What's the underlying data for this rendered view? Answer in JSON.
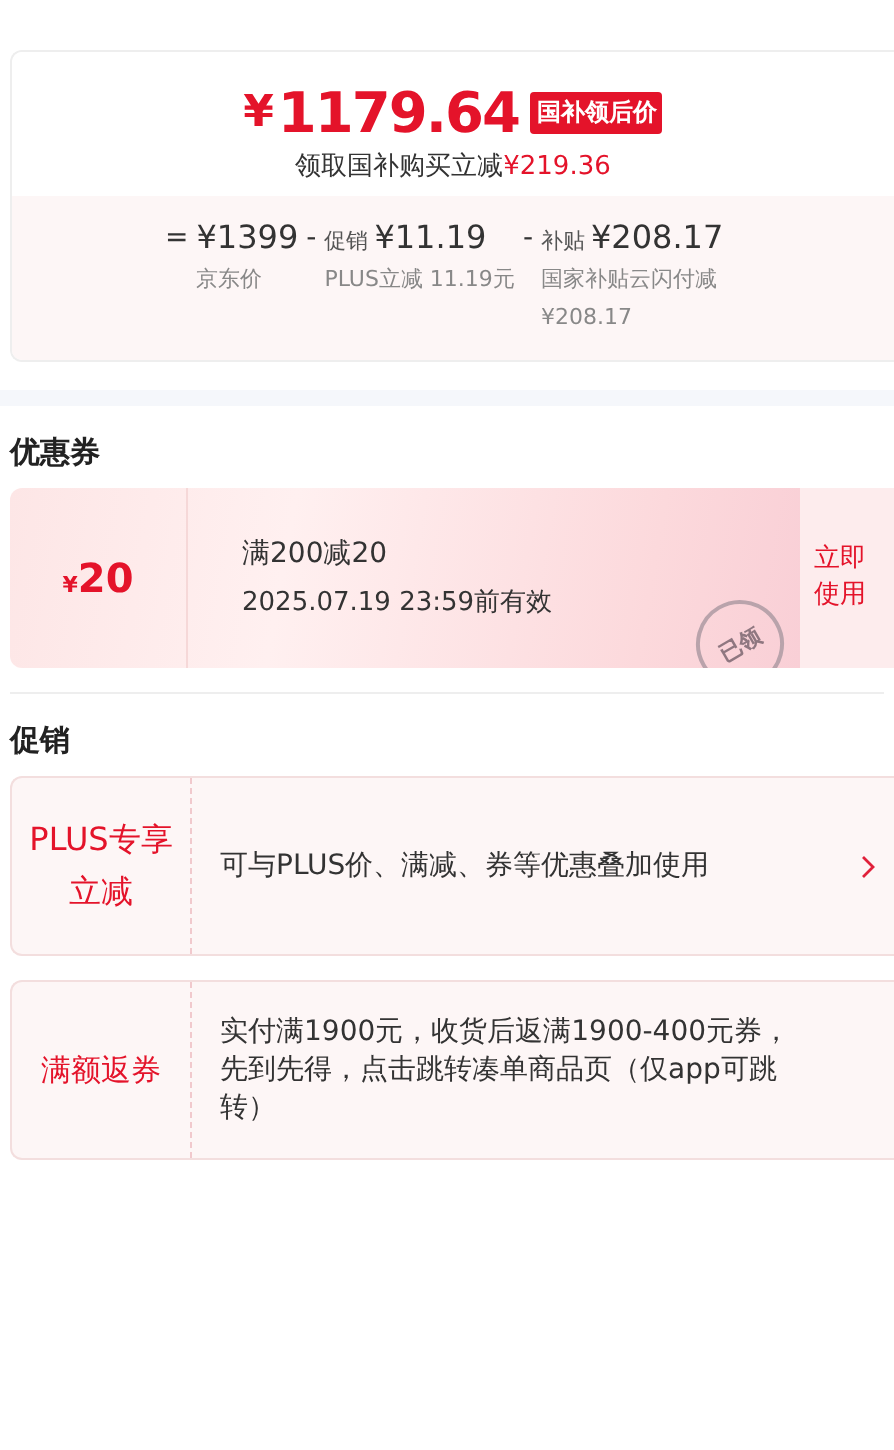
{
  "price": {
    "symbol": "¥",
    "amount": "1179.64",
    "tag": "国补领后价",
    "saving_label": "领取国补购买立减",
    "saving_amount": "¥219.36"
  },
  "breakdown": [
    {
      "op": "=",
      "amount": "¥1399",
      "note": "京东价"
    },
    {
      "op": "-",
      "label": "促销",
      "amount": "¥11.19",
      "note": "PLUS立减 11.19元"
    },
    {
      "op": "-",
      "label": "补贴",
      "amount": "¥208.17",
      "note": "国家补贴云闪付减¥208.17"
    }
  ],
  "coupons_title": "优惠券",
  "coupon": {
    "symbol": "¥",
    "value": "20",
    "condition": "满200减20",
    "validity": "2025.07.19 23:59前有效",
    "action": "立即使用",
    "stamp": "已领"
  },
  "promotions_title": "促销",
  "promotions": [
    {
      "tag": "PLUS专享立减",
      "desc": "可与PLUS价、满减、券等优惠叠加使用",
      "arrow": true
    },
    {
      "tag": "满额返券",
      "desc": "实付满1900元，收货后返满1900-400元券，先到先得，点击跳转凑单商品页（仅app可跳转）",
      "arrow": false
    }
  ]
}
